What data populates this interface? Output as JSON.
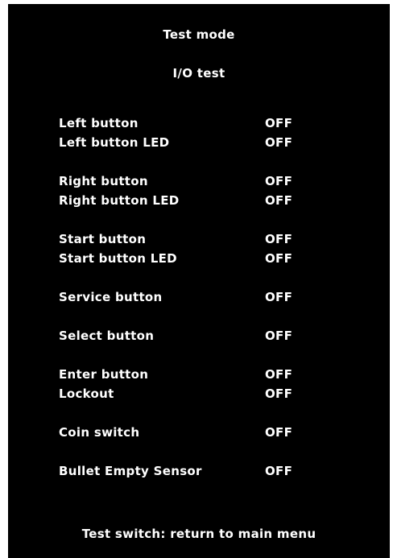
{
  "header": {
    "title": "Test mode",
    "subtitle": "I/O test"
  },
  "io_items": [
    {
      "label": "Left button",
      "value": "OFF"
    },
    {
      "label": "Left button LED",
      "value": "OFF"
    },
    {
      "label": "Right button",
      "value": "OFF"
    },
    {
      "label": "Right button LED",
      "value": "OFF"
    },
    {
      "label": "Start button",
      "value": "OFF"
    },
    {
      "label": "Start button LED",
      "value": "OFF"
    },
    {
      "label": "Service button",
      "value": "OFF"
    },
    {
      "label": "Select button",
      "value": "OFF"
    },
    {
      "label": "Enter button",
      "value": "OFF"
    },
    {
      "label": "Lockout",
      "value": "OFF"
    },
    {
      "label": "Coin switch",
      "value": "OFF"
    },
    {
      "label": "Bullet Empty Sensor",
      "value": "OFF"
    }
  ],
  "footer": {
    "hint": "Test switch: return to main menu"
  },
  "colors": {
    "background": "#000000",
    "text": "#ffffff"
  }
}
